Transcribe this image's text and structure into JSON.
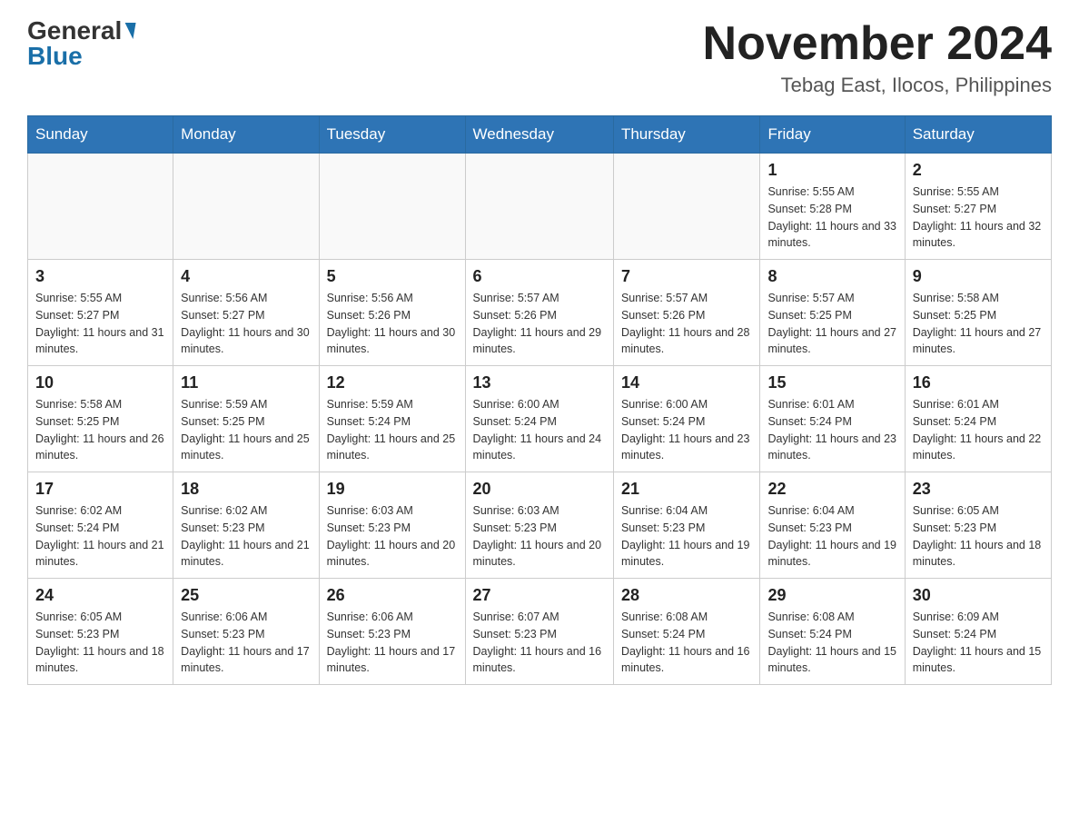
{
  "header": {
    "logo": {
      "general": "General",
      "blue": "Blue"
    },
    "title": "November 2024",
    "location": "Tebag East, Ilocos, Philippines"
  },
  "days_of_week": [
    "Sunday",
    "Monday",
    "Tuesday",
    "Wednesday",
    "Thursday",
    "Friday",
    "Saturday"
  ],
  "weeks": [
    [
      {
        "day": "",
        "sunrise": "",
        "sunset": "",
        "daylight": ""
      },
      {
        "day": "",
        "sunrise": "",
        "sunset": "",
        "daylight": ""
      },
      {
        "day": "",
        "sunrise": "",
        "sunset": "",
        "daylight": ""
      },
      {
        "day": "",
        "sunrise": "",
        "sunset": "",
        "daylight": ""
      },
      {
        "day": "",
        "sunrise": "",
        "sunset": "",
        "daylight": ""
      },
      {
        "day": "1",
        "sunrise": "Sunrise: 5:55 AM",
        "sunset": "Sunset: 5:28 PM",
        "daylight": "Daylight: 11 hours and 33 minutes."
      },
      {
        "day": "2",
        "sunrise": "Sunrise: 5:55 AM",
        "sunset": "Sunset: 5:27 PM",
        "daylight": "Daylight: 11 hours and 32 minutes."
      }
    ],
    [
      {
        "day": "3",
        "sunrise": "Sunrise: 5:55 AM",
        "sunset": "Sunset: 5:27 PM",
        "daylight": "Daylight: 11 hours and 31 minutes."
      },
      {
        "day": "4",
        "sunrise": "Sunrise: 5:56 AM",
        "sunset": "Sunset: 5:27 PM",
        "daylight": "Daylight: 11 hours and 30 minutes."
      },
      {
        "day": "5",
        "sunrise": "Sunrise: 5:56 AM",
        "sunset": "Sunset: 5:26 PM",
        "daylight": "Daylight: 11 hours and 30 minutes."
      },
      {
        "day": "6",
        "sunrise": "Sunrise: 5:57 AM",
        "sunset": "Sunset: 5:26 PM",
        "daylight": "Daylight: 11 hours and 29 minutes."
      },
      {
        "day": "7",
        "sunrise": "Sunrise: 5:57 AM",
        "sunset": "Sunset: 5:26 PM",
        "daylight": "Daylight: 11 hours and 28 minutes."
      },
      {
        "day": "8",
        "sunrise": "Sunrise: 5:57 AM",
        "sunset": "Sunset: 5:25 PM",
        "daylight": "Daylight: 11 hours and 27 minutes."
      },
      {
        "day": "9",
        "sunrise": "Sunrise: 5:58 AM",
        "sunset": "Sunset: 5:25 PM",
        "daylight": "Daylight: 11 hours and 27 minutes."
      }
    ],
    [
      {
        "day": "10",
        "sunrise": "Sunrise: 5:58 AM",
        "sunset": "Sunset: 5:25 PM",
        "daylight": "Daylight: 11 hours and 26 minutes."
      },
      {
        "day": "11",
        "sunrise": "Sunrise: 5:59 AM",
        "sunset": "Sunset: 5:25 PM",
        "daylight": "Daylight: 11 hours and 25 minutes."
      },
      {
        "day": "12",
        "sunrise": "Sunrise: 5:59 AM",
        "sunset": "Sunset: 5:24 PM",
        "daylight": "Daylight: 11 hours and 25 minutes."
      },
      {
        "day": "13",
        "sunrise": "Sunrise: 6:00 AM",
        "sunset": "Sunset: 5:24 PM",
        "daylight": "Daylight: 11 hours and 24 minutes."
      },
      {
        "day": "14",
        "sunrise": "Sunrise: 6:00 AM",
        "sunset": "Sunset: 5:24 PM",
        "daylight": "Daylight: 11 hours and 23 minutes."
      },
      {
        "day": "15",
        "sunrise": "Sunrise: 6:01 AM",
        "sunset": "Sunset: 5:24 PM",
        "daylight": "Daylight: 11 hours and 23 minutes."
      },
      {
        "day": "16",
        "sunrise": "Sunrise: 6:01 AM",
        "sunset": "Sunset: 5:24 PM",
        "daylight": "Daylight: 11 hours and 22 minutes."
      }
    ],
    [
      {
        "day": "17",
        "sunrise": "Sunrise: 6:02 AM",
        "sunset": "Sunset: 5:24 PM",
        "daylight": "Daylight: 11 hours and 21 minutes."
      },
      {
        "day": "18",
        "sunrise": "Sunrise: 6:02 AM",
        "sunset": "Sunset: 5:23 PM",
        "daylight": "Daylight: 11 hours and 21 minutes."
      },
      {
        "day": "19",
        "sunrise": "Sunrise: 6:03 AM",
        "sunset": "Sunset: 5:23 PM",
        "daylight": "Daylight: 11 hours and 20 minutes."
      },
      {
        "day": "20",
        "sunrise": "Sunrise: 6:03 AM",
        "sunset": "Sunset: 5:23 PM",
        "daylight": "Daylight: 11 hours and 20 minutes."
      },
      {
        "day": "21",
        "sunrise": "Sunrise: 6:04 AM",
        "sunset": "Sunset: 5:23 PM",
        "daylight": "Daylight: 11 hours and 19 minutes."
      },
      {
        "day": "22",
        "sunrise": "Sunrise: 6:04 AM",
        "sunset": "Sunset: 5:23 PM",
        "daylight": "Daylight: 11 hours and 19 minutes."
      },
      {
        "day": "23",
        "sunrise": "Sunrise: 6:05 AM",
        "sunset": "Sunset: 5:23 PM",
        "daylight": "Daylight: 11 hours and 18 minutes."
      }
    ],
    [
      {
        "day": "24",
        "sunrise": "Sunrise: 6:05 AM",
        "sunset": "Sunset: 5:23 PM",
        "daylight": "Daylight: 11 hours and 18 minutes."
      },
      {
        "day": "25",
        "sunrise": "Sunrise: 6:06 AM",
        "sunset": "Sunset: 5:23 PM",
        "daylight": "Daylight: 11 hours and 17 minutes."
      },
      {
        "day": "26",
        "sunrise": "Sunrise: 6:06 AM",
        "sunset": "Sunset: 5:23 PM",
        "daylight": "Daylight: 11 hours and 17 minutes."
      },
      {
        "day": "27",
        "sunrise": "Sunrise: 6:07 AM",
        "sunset": "Sunset: 5:23 PM",
        "daylight": "Daylight: 11 hours and 16 minutes."
      },
      {
        "day": "28",
        "sunrise": "Sunrise: 6:08 AM",
        "sunset": "Sunset: 5:24 PM",
        "daylight": "Daylight: 11 hours and 16 minutes."
      },
      {
        "day": "29",
        "sunrise": "Sunrise: 6:08 AM",
        "sunset": "Sunset: 5:24 PM",
        "daylight": "Daylight: 11 hours and 15 minutes."
      },
      {
        "day": "30",
        "sunrise": "Sunrise: 6:09 AM",
        "sunset": "Sunset: 5:24 PM",
        "daylight": "Daylight: 11 hours and 15 minutes."
      }
    ]
  ]
}
